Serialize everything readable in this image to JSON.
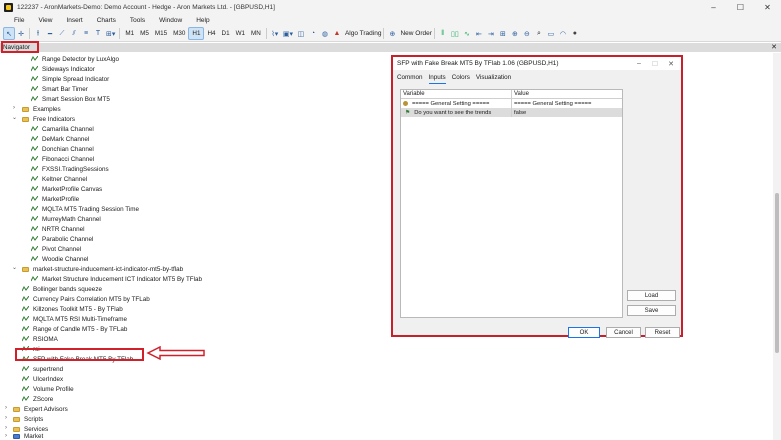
{
  "window": {
    "title": "122237 - AronMarkets-Demo: Demo Account - Hedge - Aron Markets Ltd. - [GBPUSD,H1]",
    "controls": [
      "–",
      "☐",
      "✕"
    ]
  },
  "menu": [
    "File",
    "View",
    "Insert",
    "Charts",
    "Tools",
    "Window",
    "Help"
  ],
  "toolbar": {
    "timeframes": [
      "M1",
      "M5",
      "M15",
      "M30",
      "H1",
      "H4",
      "D1",
      "W1",
      "MN"
    ],
    "active_timeframe": "H1",
    "algo_trading": "Algo Trading",
    "new_order": "New Order"
  },
  "navigator": {
    "title": "Navigator",
    "close": "✕",
    "items": [
      "Range Detector by LuxAlgo",
      "Sideways Indicator",
      "Simple Spread Indicator",
      "Smart Bar Timer",
      "Smart Session Box MT5",
      "Examples",
      "Free Indicators",
      "Camarilla Channel",
      "DeMark Channel",
      "Donchian Channel",
      "Fibonacci Channel",
      "FXSSI.TradingSessions",
      "Keltner Channel",
      "MarketProfile Canvas",
      "MarketProfile",
      "MQLTA MT5 Trading Session Time",
      "MurreyMath Channel",
      "NRTR Channel",
      "Parabolic Channel",
      "Pivot Channel",
      "Woodie Channel",
      "market-structure-inducement-ict-indicator-mt5-by-tflab",
      "Market Structure Inducement ICT Indicator MT5 By TFlab",
      "Bollinger bands squeeze",
      "Currency Pairs Correlation MT5 by TFLab",
      "Killzones Toolkit MT5 - By TFlab",
      "MQLTA MT5 RSI Multi-Timeframe",
      "Range of Candle MT5 - By TFLab",
      "RSIOMA",
      "rsi",
      "SFP with Fake Break MT5 By TFlab",
      "supertrend",
      "UlcerIndex",
      "Volume Profile",
      "ZScore",
      "Expert Advisors",
      "Scripts",
      "Services",
      "Market"
    ]
  },
  "dialog": {
    "title": "SFP with Fake Break MT5 By TFlab 1.06 (GBPUSD,H1)",
    "tabs": [
      "Common",
      "Inputs",
      "Colors",
      "Visualization"
    ],
    "active_tab": "Inputs",
    "columns": [
      "Variable",
      "Value"
    ],
    "rows": [
      {
        "variable": "===== General Setting =====",
        "value": "===== General Setting ====="
      },
      {
        "variable": "Do you want to see the trends",
        "value": "false"
      }
    ],
    "buttons": {
      "load": "Load",
      "save": "Save",
      "ok": "OK",
      "cancel": "Cancel",
      "reset": "Reset"
    }
  }
}
